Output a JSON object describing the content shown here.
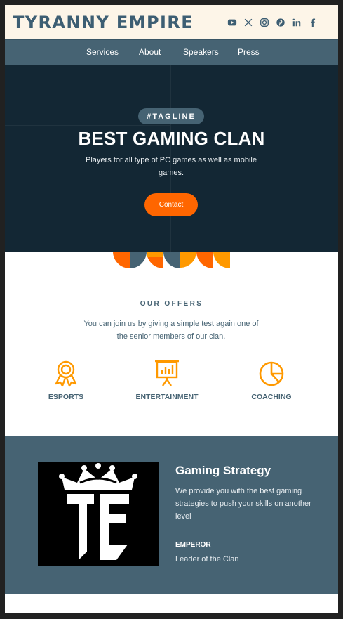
{
  "header": {
    "brand": "TYRANNY EMPIRE",
    "socials": [
      {
        "name": "youtube-icon"
      },
      {
        "name": "x-icon"
      },
      {
        "name": "instagram-icon"
      },
      {
        "name": "pinterest-icon"
      },
      {
        "name": "linkedin-icon"
      },
      {
        "name": "facebook-icon"
      }
    ]
  },
  "nav": {
    "items": [
      {
        "label": "Services"
      },
      {
        "label": "About"
      },
      {
        "label": "Speakers"
      },
      {
        "label": "Press"
      }
    ]
  },
  "hero": {
    "tagline": "#TAGLINE",
    "title": "BEST GAMING CLAN",
    "subtitle": "Players for all type of PC games as well as mobile games.",
    "cta": "Contact"
  },
  "offers": {
    "title": "OUR OFFERS",
    "text": "You can join us by giving a simple test again one of the senior members of our clan.",
    "items": [
      {
        "label": "ESPORTS",
        "icon": "award-icon"
      },
      {
        "label": "ENTERTAINMENT",
        "icon": "presentation-icon"
      },
      {
        "label": "COACHING",
        "icon": "pie-chart-icon"
      }
    ]
  },
  "strategy": {
    "logo_text": "TE",
    "title": "Gaming Strategy",
    "text": "We provide you with the best gaming strategies to push your skills on another level",
    "role": "EMPEROR",
    "role_desc": "Leader of the Clan"
  },
  "colors": {
    "dark_navy": "#132734",
    "slate": "#466373",
    "cream": "#fdf5e8",
    "accent_orange": "#ff6600",
    "icon_orange": "#ff9900"
  }
}
